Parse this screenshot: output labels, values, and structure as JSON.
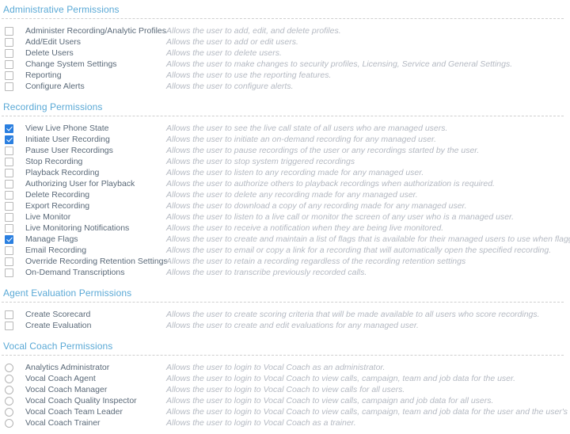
{
  "colors": {
    "section_header": "#5aa9d6",
    "label_text": "#5a6978",
    "description_text": "#b4b9c2",
    "checkbox_checked": "#2a7fe0",
    "rule": "#cfcfcf"
  },
  "sections": [
    {
      "title": "Administrative Permissions",
      "control_type": "checkbox",
      "rows": [
        {
          "label": "Administer Recording/Analytic Profiles",
          "description": "Allows the user to add, edit, and delete profiles.",
          "checked": false
        },
        {
          "label": "Add/Edit Users",
          "description": "Allows the user to add or edit users.",
          "checked": false
        },
        {
          "label": "Delete Users",
          "description": "Allows the user to delete users.",
          "checked": false
        },
        {
          "label": "Change System Settings",
          "description": "Allows the user to make changes to security profiles, Licensing, Service and General Settings.",
          "checked": false
        },
        {
          "label": "Reporting",
          "description": "Allows the user to use the reporting features.",
          "checked": false
        },
        {
          "label": "Configure Alerts",
          "description": "Allows the user to configure alerts.",
          "checked": false
        }
      ]
    },
    {
      "title": "Recording Permissions",
      "control_type": "checkbox",
      "rows": [
        {
          "label": "View Live Phone State",
          "description": "Allows the user to see the live call state of all users who are managed users.",
          "checked": true
        },
        {
          "label": "Initiate User Recording",
          "description": "Allows the user to initiate an on-demand recording for any managed user.",
          "checked": true
        },
        {
          "label": "Pause User Recordings",
          "description": "Allows the user to pause recordings of the user or any recordings started by the user.",
          "checked": false
        },
        {
          "label": "Stop Recording",
          "description": "Allows the user to stop system triggered recordings",
          "checked": false
        },
        {
          "label": "Playback Recording",
          "description": "Allows the user to listen to any recording made for any managed user.",
          "checked": false
        },
        {
          "label": "Authorizing User for Playback",
          "description": "Allows the user to authorize others to playback recordings when authorization is required.",
          "checked": false
        },
        {
          "label": "Delete Recording",
          "description": "Allows the user to delete any recording made for any managed user.",
          "checked": false
        },
        {
          "label": "Export Recording",
          "description": "Allows the user to download a copy of any recording made for any managed user.",
          "checked": false
        },
        {
          "label": "Live Monitor",
          "description": "Allows the user to listen to a live call or monitor the screen of any user who is a managed user.",
          "checked": false
        },
        {
          "label": "Live Monitoring Notifications",
          "description": "Allows the user to receive a notification when they are being live monitored.",
          "checked": false
        },
        {
          "label": "Manage Flags",
          "description": "Allows the user to create and maintain a list of flags that is available for their managed users to use when flagging calls.",
          "checked": true
        },
        {
          "label": "Email Recording",
          "description": "Allows the user to email or copy a link for a recording that will automatically open the specified recording.",
          "checked": false
        },
        {
          "label": "Override Recording Retention Settings",
          "description": "Allows the user to retain a recording regardless of the recording retention settings",
          "checked": false
        },
        {
          "label": "On-Demand Transcriptions",
          "description": "Allows the user to transcribe previously recorded calls.",
          "checked": false
        }
      ]
    },
    {
      "title": "Agent Evaluation Permissions",
      "control_type": "checkbox",
      "rows": [
        {
          "label": "Create Scorecard",
          "description": "Allows the user to create scoring criteria that will be made available to all users who score recordings.",
          "checked": false
        },
        {
          "label": "Create Evaluation",
          "description": "Allows the user to create and edit evaluations for any managed user.",
          "checked": false
        }
      ]
    },
    {
      "title": "Vocal Coach Permissions",
      "control_type": "radio",
      "rows": [
        {
          "label": "Analytics Administrator",
          "description": "Allows the user to login to Vocal Coach as an administrator.",
          "checked": false
        },
        {
          "label": "Vocal Coach Agent",
          "description": "Allows the user to login to Vocal Coach to view calls, campaign, team and job data for the user.",
          "checked": false
        },
        {
          "label": "Vocal Coach Manager",
          "description": "Allows the user to login to Vocal Coach to view calls for all users.",
          "checked": false
        },
        {
          "label": "Vocal Coach Quality Inspector",
          "description": "Allows the user to login to Vocal Coach to view calls, campaign and job data for all users.",
          "checked": false
        },
        {
          "label": "Vocal Coach Team Leader",
          "description": "Allows the user to login to Vocal Coach to view calls, campaign, team and job data for the user and the user's team.",
          "checked": false
        },
        {
          "label": "Vocal Coach Trainer",
          "description": "Allows the user to login to Vocal Coach as a trainer.",
          "checked": false
        }
      ]
    }
  ]
}
